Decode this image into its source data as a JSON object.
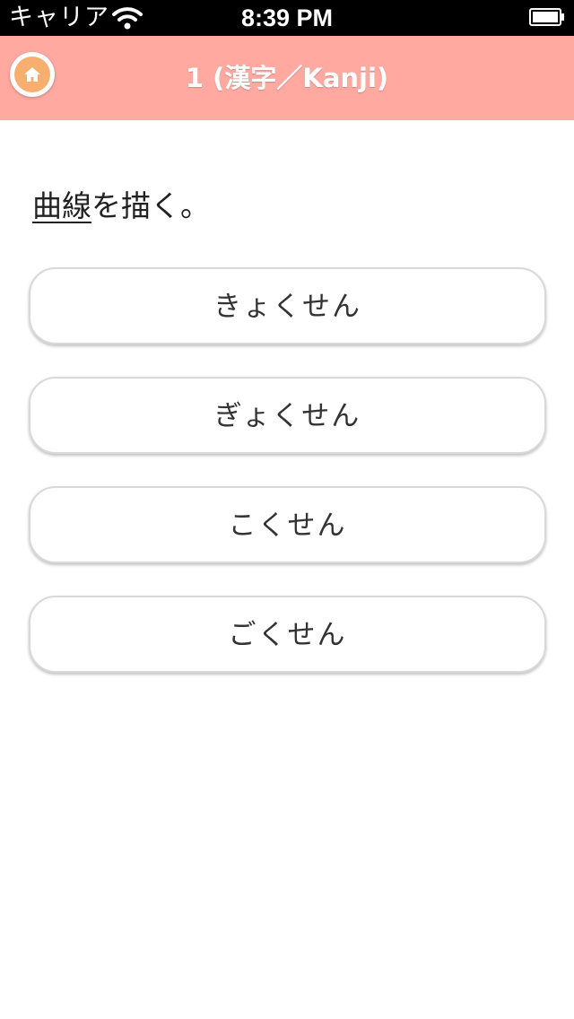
{
  "status_bar": {
    "carrier": "キャリア",
    "time": "8:39 PM",
    "icons": [
      "wifi-icon",
      "battery-icon"
    ]
  },
  "nav_bar": {
    "title": "1 (漢字／Kanji)",
    "home_icon": "home-icon",
    "color": "#ffa9a1",
    "home_color": "#f7ae6e"
  },
  "question": {
    "target": "曲線",
    "rest": "を描く。"
  },
  "choices": [
    {
      "label": "きょくせん"
    },
    {
      "label": "ぎょくせん"
    },
    {
      "label": "こくせん"
    },
    {
      "label": "ごくせん"
    }
  ]
}
